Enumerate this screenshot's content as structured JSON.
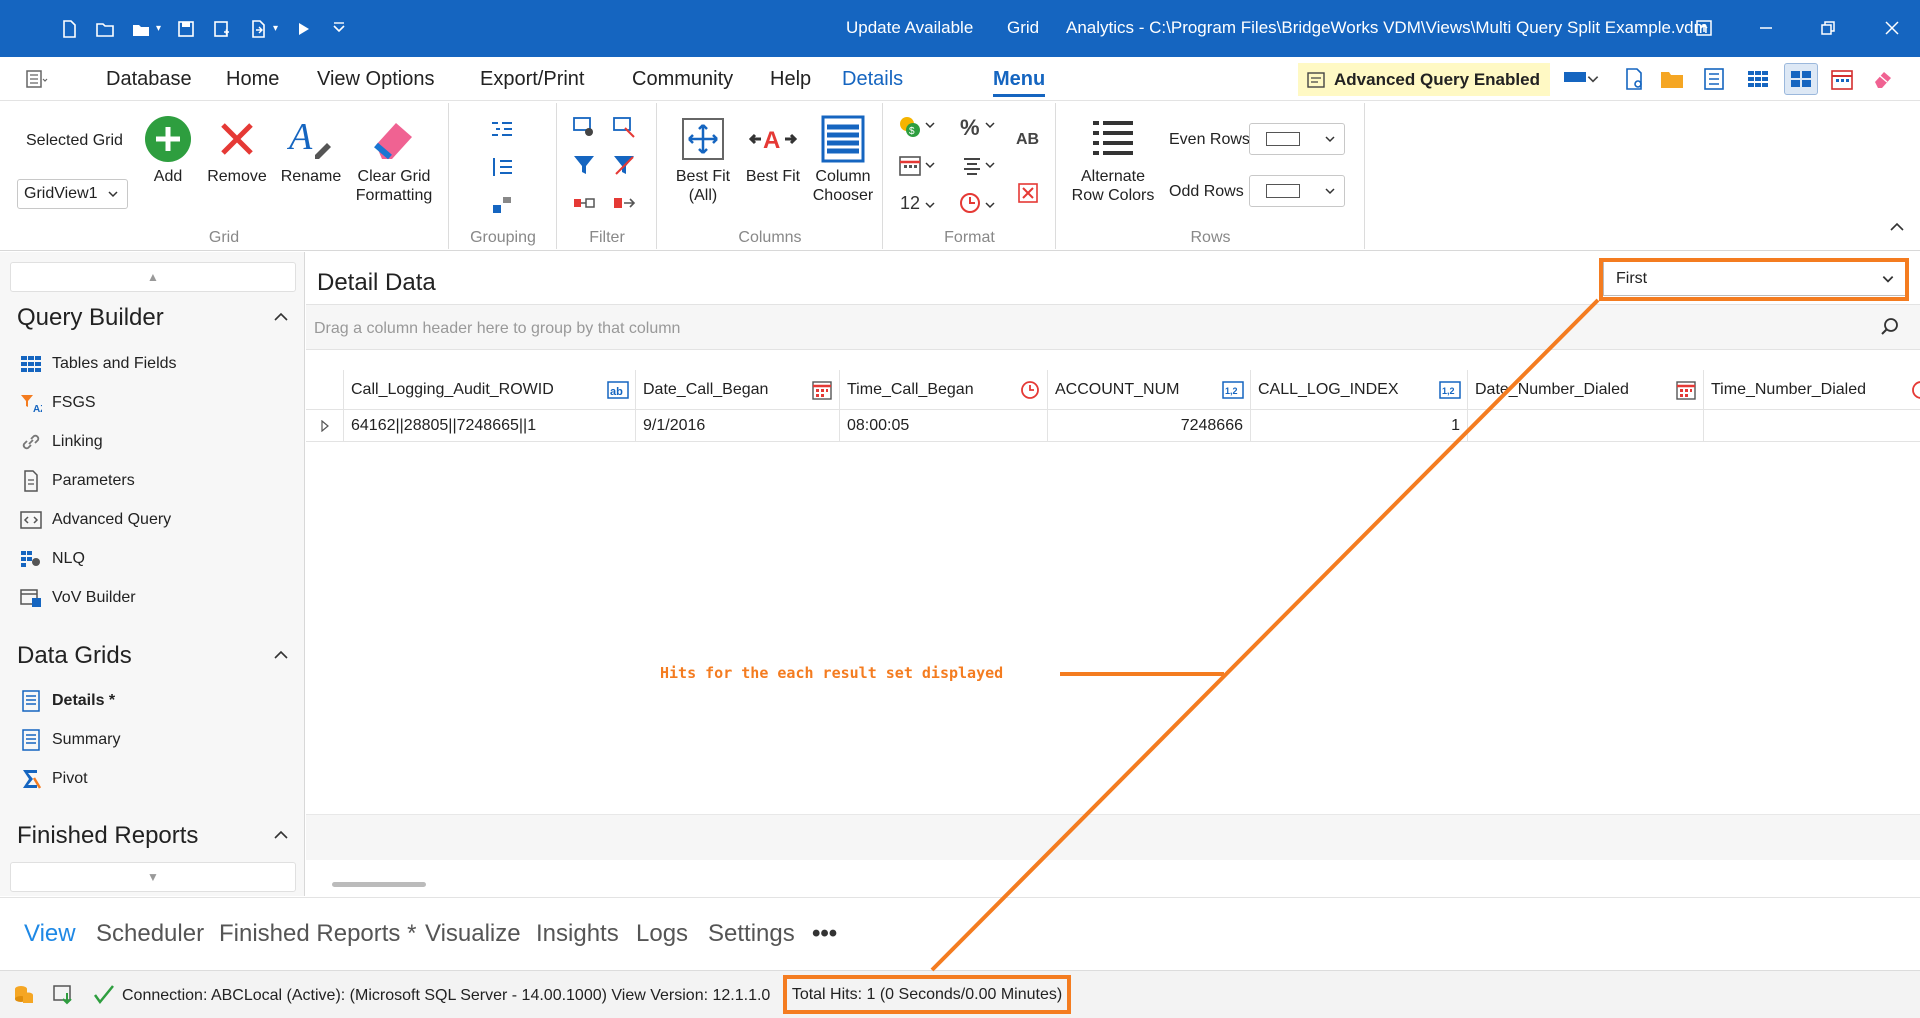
{
  "titlebar": {
    "update": "Update Available",
    "grid": "Grid",
    "title": "Analytics - C:\\Program Files\\BridgeWorks VDM\\Views\\Multi Query Split Example.vdm",
    "qat_icons": [
      "new-file-icon",
      "open-folder-icon",
      "open-recent-icon",
      "save-icon",
      "save-as-icon",
      "export-icon",
      "run-icon",
      "customize-icon"
    ]
  },
  "menubar": {
    "items": [
      "Database",
      "Home",
      "View Options",
      "Export/Print",
      "Community",
      "Help",
      "Details",
      "Menu"
    ],
    "badge": "Advanced Query Enabled"
  },
  "ribbon": {
    "grid_group": {
      "label": "Grid",
      "selected_grid_label": "Selected Grid",
      "selected_grid_value": "GridView1",
      "add": "Add",
      "remove": "Remove",
      "rename": "Rename",
      "clear_line1": "Clear Grid",
      "clear_line2": "Formatting"
    },
    "grouping_label": "Grouping",
    "filter_label": "Filter",
    "columns_group": {
      "label": "Columns",
      "bestfit_all_line1": "Best Fit",
      "bestfit_all_line2": "(All)",
      "bestfit": "Best Fit",
      "chooser_line1": "Column",
      "chooser_line2": "Chooser"
    },
    "format_group": {
      "label": "Format",
      "font_size": "12"
    },
    "rows_group": {
      "label": "Rows",
      "alt_line1": "Alternate",
      "alt_line2": "Row Colors",
      "even_rows": "Even Rows",
      "odd_rows": "Odd Rows"
    }
  },
  "leftpane": {
    "query_builder": "Query Builder",
    "qb_items": [
      "Tables and Fields",
      "FSGS",
      "Linking",
      "Parameters",
      "Advanced Query",
      "NLQ",
      "VoV Builder"
    ],
    "data_grids": "Data Grids",
    "dg_items": [
      "Details *",
      "Summary",
      "Pivot"
    ],
    "finished_reports": "Finished Reports"
  },
  "main": {
    "title": "Detail Data",
    "result_select": "First",
    "group_hint": "Drag a column header here to group by that column",
    "columns": [
      "Call_Logging_Audit_ROWID",
      "Date_Call_Began",
      "Time_Call_Began",
      "ACCOUNT_NUM",
      "CALL_LOG_INDEX",
      "Date_Number_Dialed",
      "Time_Number_Dialed"
    ],
    "rows": [
      [
        "64162||28805||7248665||1",
        "9/1/2016",
        "08:00:05",
        "7248666",
        "1",
        "",
        ""
      ]
    ]
  },
  "bottomtabs": [
    "View",
    "Scheduler",
    "Finished Reports *",
    "Visualize",
    "Insights",
    "Logs",
    "Settings",
    "•••"
  ],
  "statusbar": {
    "connection": "Connection: ABCLocal (Active): (Microsoft SQL Server - 14.00.1000) View Version: 12.1.1.0",
    "total_hits": "Total Hits: 1 (0 Seconds/0.00 Minutes)"
  },
  "annotation": {
    "text": "Hits for the each result set displayed",
    "color": "#f47c20"
  },
  "colors": {
    "accent": "#1565c0",
    "annotation": "#f47c20",
    "add_green": "#2e9e3f",
    "remove_red": "#e53935"
  }
}
